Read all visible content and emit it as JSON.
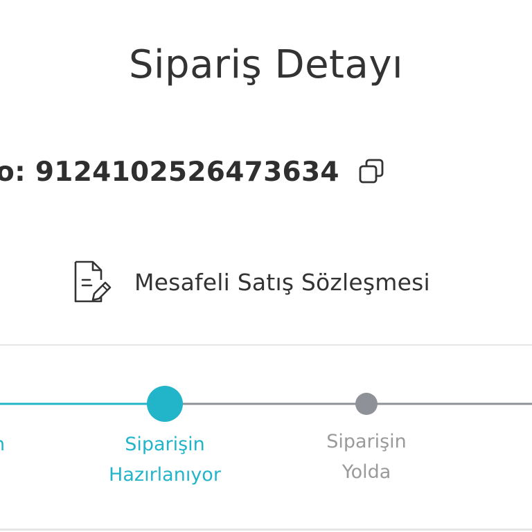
{
  "header": {
    "title": "Sipariş Detayı"
  },
  "order": {
    "number_text": "o: 9124102526473634"
  },
  "contract": {
    "label": "Mesafeli Satış Sözleşmesi"
  },
  "tracker": {
    "steps": [
      {
        "label_line1": "n",
        "label_line2": "",
        "status": "completed"
      },
      {
        "label_line1": "Siparişin",
        "label_line2": "Hazırlanıyor",
        "status": "active"
      },
      {
        "label_line1": "Siparişin",
        "label_line2": "Yolda",
        "status": "pending"
      }
    ],
    "colors": {
      "active": "#22b4c9",
      "inactive": "#8f9199"
    }
  }
}
